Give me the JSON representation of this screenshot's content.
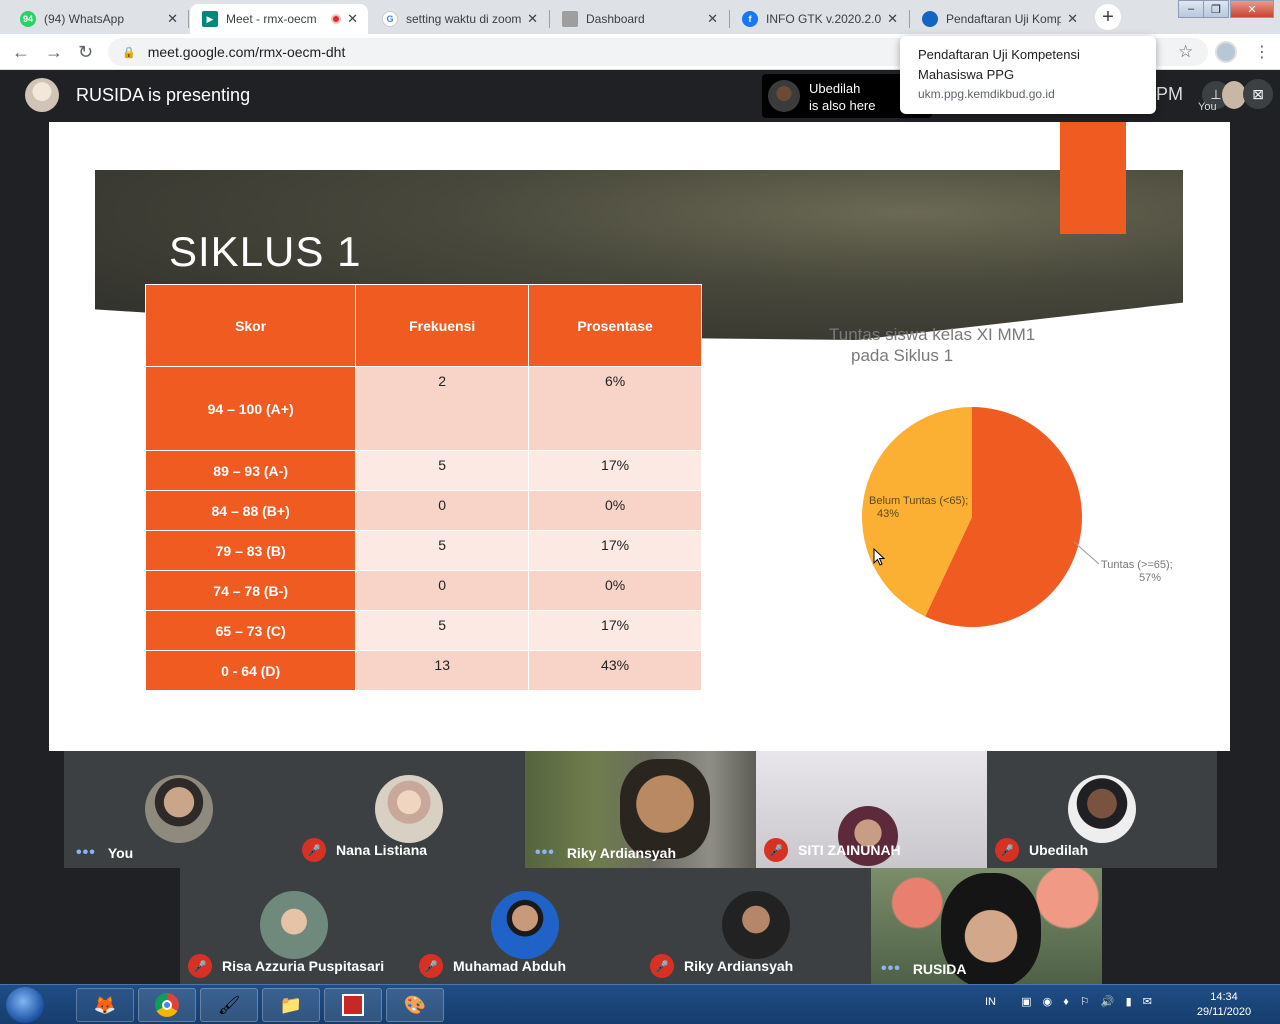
{
  "browser": {
    "tabs": [
      {
        "label": "(94) WhatsApp",
        "favicon": "whatsapp-icon",
        "color": "#25d366"
      },
      {
        "label": "Meet - rmx-oecm",
        "favicon": "google-meet-icon",
        "color": "#00897b",
        "recording": true
      },
      {
        "label": "setting waktu di zoom",
        "favicon": "google-icon",
        "color": "#4285f4"
      },
      {
        "label": "Dashboard",
        "favicon": "document-icon",
        "color": "#9e9e9e"
      },
      {
        "label": "INFO GTK v.2020.2.0",
        "favicon": "facebook-icon",
        "color": "#1877f2"
      },
      {
        "label": "Pendaftaran Uji Komp",
        "favicon": "tut-wuri-icon",
        "color": "#1565c0"
      }
    ],
    "url": "meet.google.com/rmx-oecm-dht",
    "tooltip": {
      "title": "Pendaftaran Uji Kompetensi Mahasiswa PPG",
      "url": "ukm.ppg.kemdikbud.go.id"
    }
  },
  "meet": {
    "presenting": "RUSIDA is presenting",
    "also_here": {
      "name": "Ubedilah",
      "text": "is also here"
    },
    "clock_fragment": "PM",
    "you_label": "You",
    "participants": [
      {
        "name": "You",
        "muted": false
      },
      {
        "name": "Nana Listiana",
        "muted": true
      },
      {
        "name": "Riky Ardiansyah",
        "muted": false,
        "video": true
      },
      {
        "name": "SITI ZAINUNAH",
        "muted": true,
        "video": true
      },
      {
        "name": "Ubedilah",
        "muted": true
      },
      {
        "name": "Risa Azzuria Puspitasari",
        "muted": true
      },
      {
        "name": "Muhamad Abduh",
        "muted": true
      },
      {
        "name": "Riky Ardiansyah",
        "muted": true
      },
      {
        "name": "RUSIDA",
        "muted": false,
        "video": true
      }
    ]
  },
  "slide": {
    "title": "SIKLUS 1",
    "accent_color": "#f05b22",
    "table": {
      "headers": [
        "Skor",
        "Frekuensi",
        "Prosentase"
      ],
      "rows": [
        {
          "skor": "94 – 100 (A+)",
          "frekuensi": "2",
          "prosentase": "6%"
        },
        {
          "skor": "89 – 93 (A-)",
          "frekuensi": "5",
          "prosentase": "17%"
        },
        {
          "skor": "84 – 88 (B+)",
          "frekuensi": "0",
          "prosentase": "0%"
        },
        {
          "skor": "79 – 83 (B)",
          "frekuensi": "5",
          "prosentase": "17%"
        },
        {
          "skor": "74 – 78 (B-)",
          "frekuensi": "0",
          "prosentase": "0%"
        },
        {
          "skor": "65 – 73 (C)",
          "frekuensi": "5",
          "prosentase": "17%"
        },
        {
          "skor": "0 - 64 (D)",
          "frekuensi": "13",
          "prosentase": "43%"
        }
      ]
    },
    "chart_title_line1": "Tuntas siswa kelas XI MM1",
    "chart_title_line2": "pada Siklus 1"
  },
  "chart_data": {
    "type": "pie",
    "title": "Tuntas siswa kelas XI MM1 pada Siklus 1",
    "slices": [
      {
        "label": "Tuntas (>=65); 57%",
        "value": 57,
        "color": "#f05b22"
      },
      {
        "label": "Belum Tuntas (<65); 43%",
        "value": 43,
        "color": "#fbb034"
      }
    ]
  },
  "taskbar": {
    "apps": [
      "firefox-icon",
      "chrome-icon",
      "paint-icon",
      "explorer-icon",
      "acrobat-icon",
      "palette-icon"
    ],
    "tray_lang": "IN",
    "time": "14:34",
    "date": "29/11/2020"
  }
}
